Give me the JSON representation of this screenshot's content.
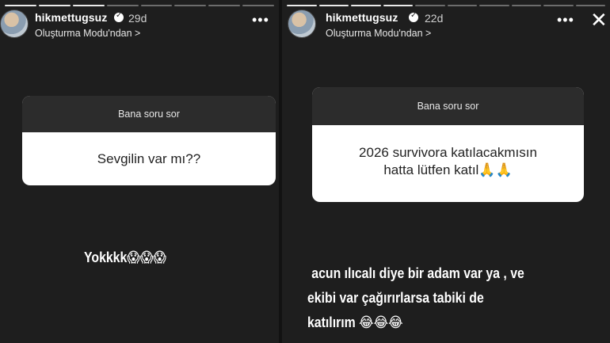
{
  "left_story": {
    "username": "hikmettugsuz",
    "age": "29d",
    "subtitle": "Oluşturma Modu'ndan >",
    "more": "•••",
    "question_header": "Bana soru sor",
    "question": "Sevgilin var mı??",
    "answer": "Yokkkk😱😱😱"
  },
  "right_story": {
    "username": "hikmettugsuz",
    "age": "22d",
    "subtitle": "Oluşturma Modu'ndan >",
    "more": "•••",
    "close": "✕",
    "question_header": "Bana soru sor",
    "question_line1": "2026 survivora katılacakmısın",
    "question_line2": "hatta lütfen katıl🙏🙏",
    "answer_line1": "acun ılıcalı diye bir adam var ya , ve",
    "answer_line2": "ekibi var çağırırlarsa tabiki de",
    "answer_line3": "katılırım 😂😂😂"
  }
}
